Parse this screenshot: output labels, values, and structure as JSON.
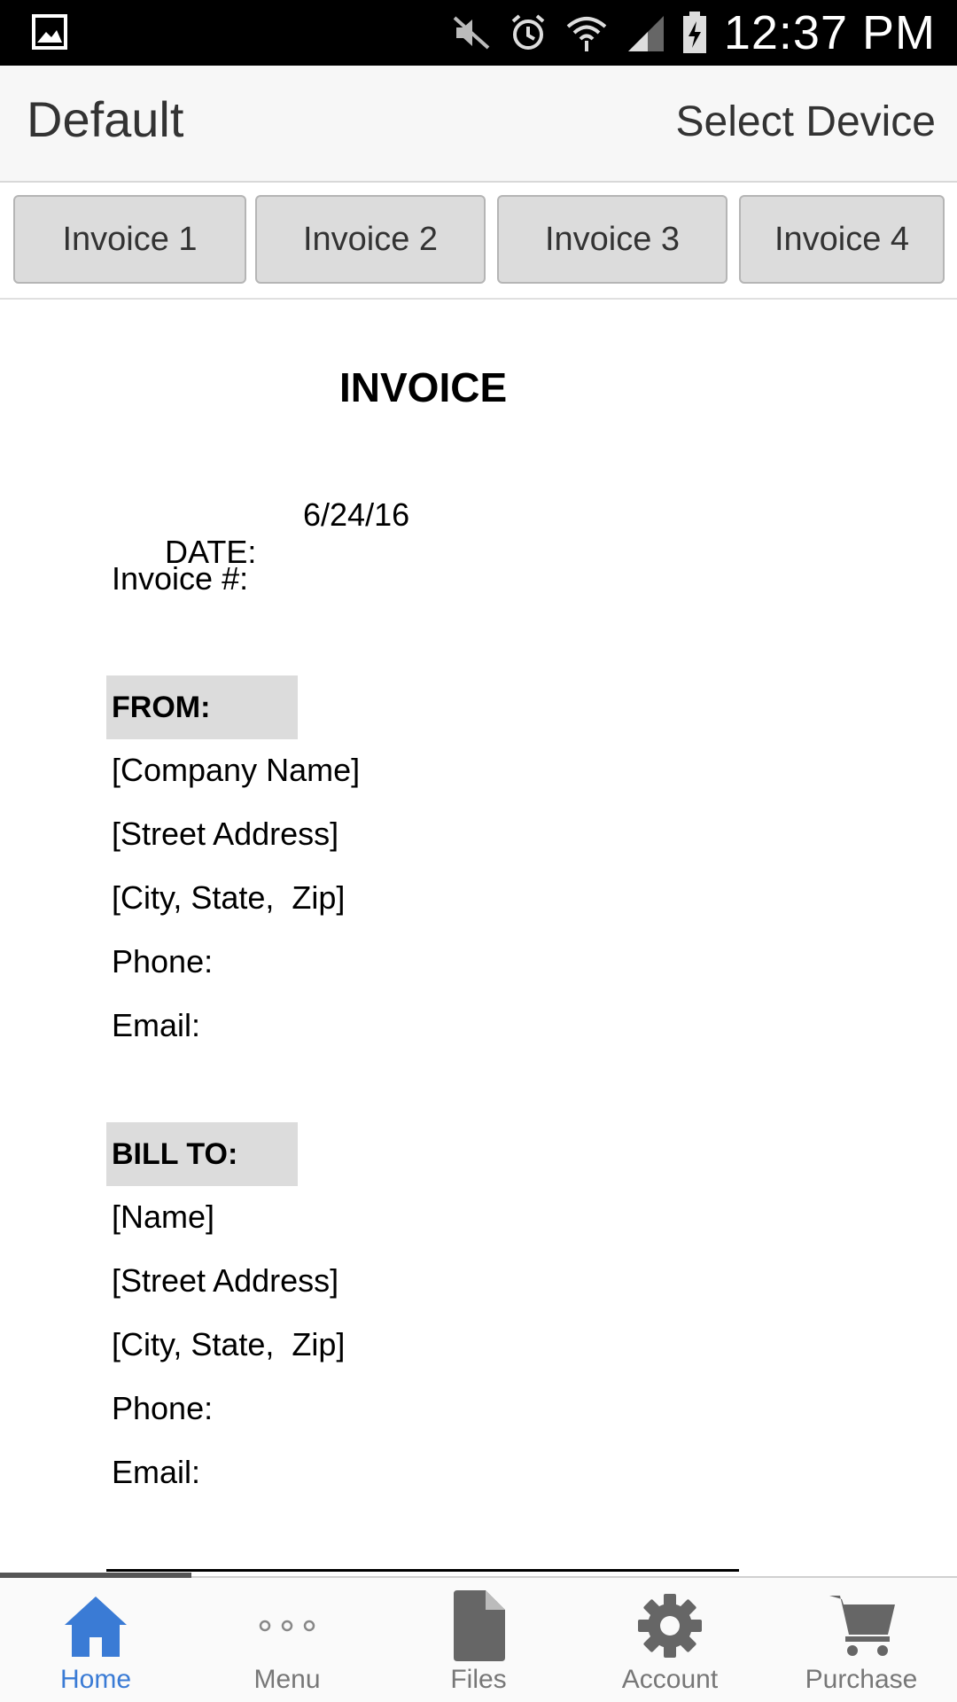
{
  "status_bar": {
    "time": "12:37 PM",
    "icons": [
      "gallery-icon",
      "mute-icon",
      "alarm-icon",
      "wifi-icon",
      "signal-icon",
      "battery-charging-icon"
    ]
  },
  "app_bar": {
    "title": "Default",
    "action_label": "Select Device"
  },
  "tabs": [
    {
      "label": "Invoice 1"
    },
    {
      "label": "Invoice 2"
    },
    {
      "label": "Invoice 3"
    },
    {
      "label": "Invoice 4"
    }
  ],
  "document": {
    "title": "INVOICE",
    "date_label": "DATE:",
    "date_value": "6/24/16",
    "invoice_label": "Invoice #:",
    "from": {
      "heading": "FROM:",
      "company": "[Company Name]",
      "street": "[Street Address]",
      "city": "[City, State,  Zip]",
      "phone": "Phone:",
      "email": "Email:"
    },
    "bill_to": {
      "heading": "BILL TO:",
      "name": "[Name]",
      "street": "[Street Address]",
      "city": "[City, State,  Zip]",
      "phone": "Phone:",
      "email": "Email:"
    }
  },
  "bottom_nav": {
    "active": "Home",
    "active_color": "#3a7bd5",
    "items": [
      {
        "label": "Home",
        "icon": "home-icon"
      },
      {
        "label": "Menu",
        "icon": "more-icon"
      },
      {
        "label": "Files",
        "icon": "file-icon"
      },
      {
        "label": "Account",
        "icon": "gear-icon"
      },
      {
        "label": "Purchase",
        "icon": "cart-icon"
      }
    ]
  }
}
